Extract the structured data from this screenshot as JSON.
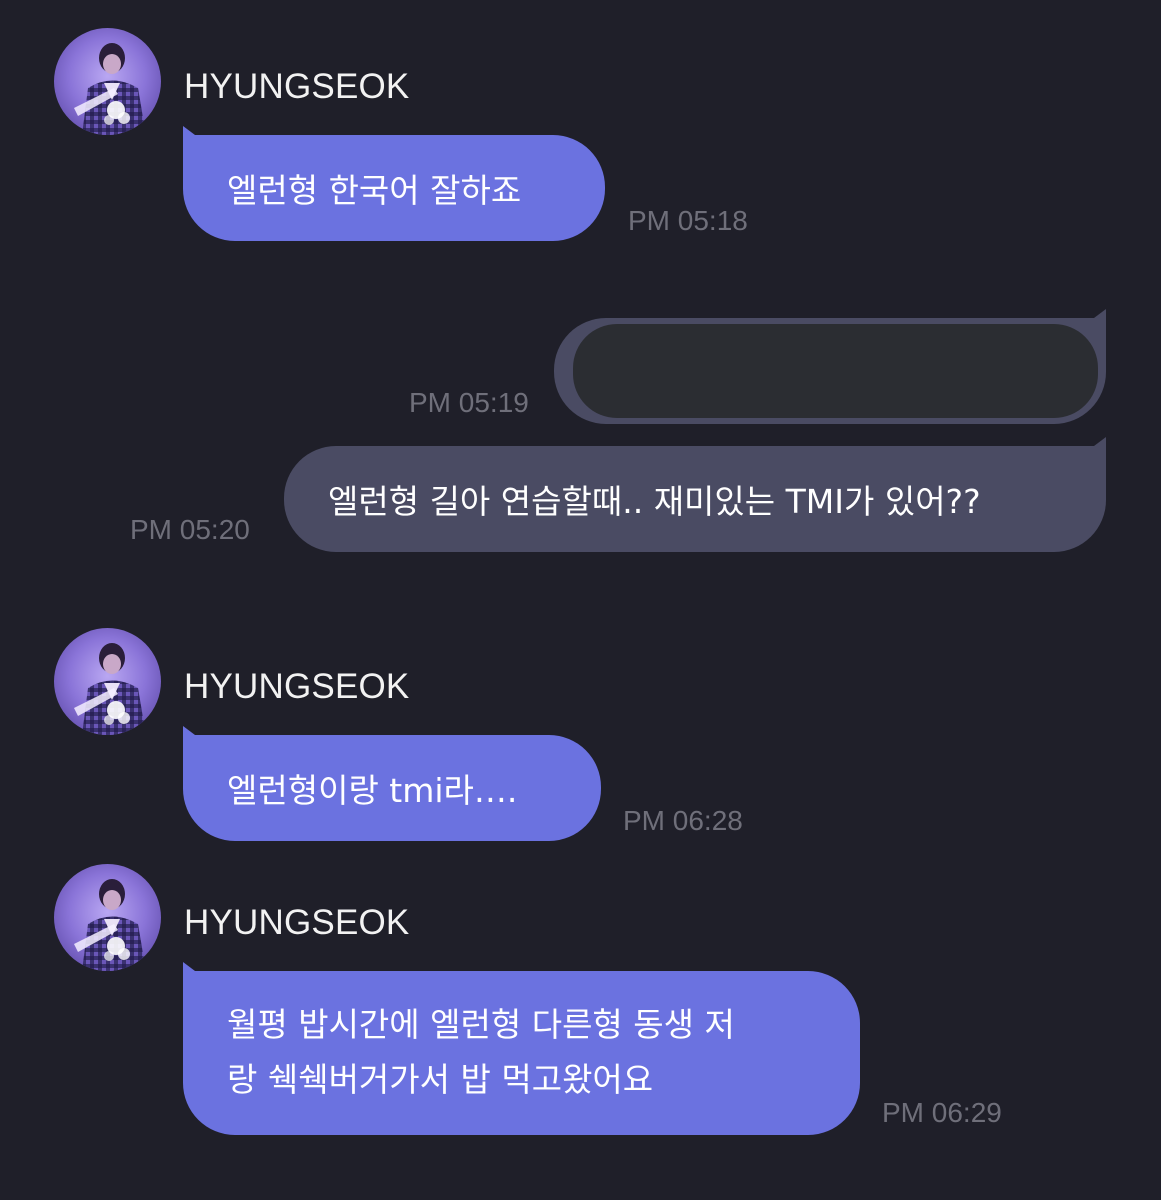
{
  "messages": [
    {
      "sender": "HYUNGSEOK",
      "text": "엘런형 한국어 잘하죠",
      "time": "PM 05:18"
    },
    {
      "time": "PM 05:19"
    },
    {
      "text": "엘런형 길아 연습할때.. 재미있는 TMI가 있어??",
      "time": "PM 05:20"
    },
    {
      "sender": "HYUNGSEOK",
      "text": "엘런형이랑 tmi라….",
      "time": "PM 06:28"
    },
    {
      "sender": "HYUNGSEOK",
      "lines": [
        "월평 밥시간에 엘런형 다른형 동생 저",
        "랑 쉑쉑버거가서 밥 먹고왔어요"
      ],
      "time": "PM 06:29"
    }
  ],
  "colors": {
    "background": "#1f1f29",
    "incoming_bubble": "#6b72e0",
    "outgoing_bubble": "#4a4b63",
    "redaction": "#2b2d32",
    "timestamp": "#6f6f7a"
  },
  "icons": {
    "avatar": "profile-photo-avatar"
  }
}
